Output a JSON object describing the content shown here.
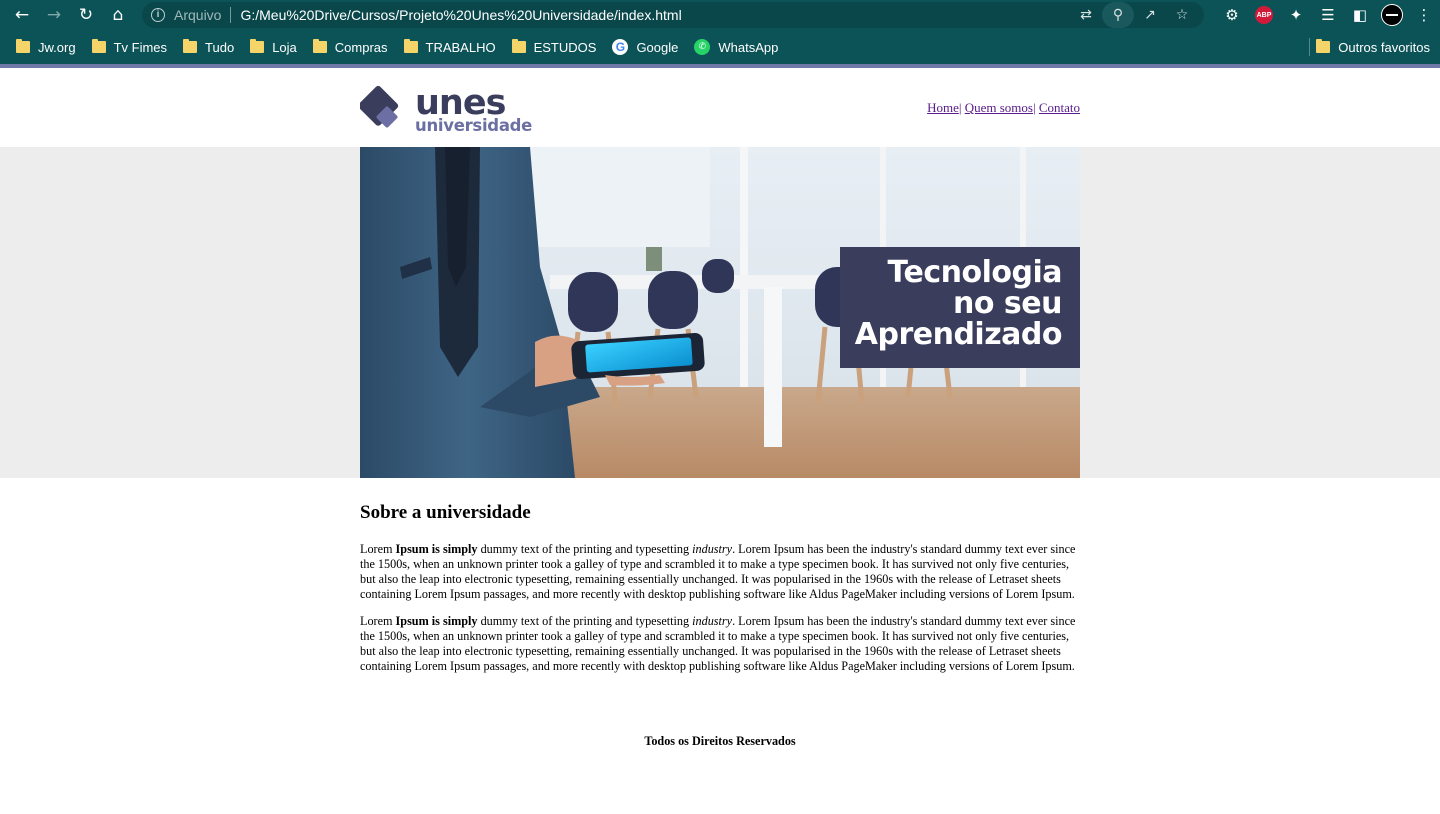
{
  "browser": {
    "address_scheme": "Arquivo",
    "address_url": "G:/Meu%20Drive/Cursos/Projeto%20Unes%20Universidade/index.html",
    "extensions": {
      "adblock_label": "ABP"
    },
    "bookmarks": [
      {
        "label": "Jw.org",
        "icon": "folder-icon"
      },
      {
        "label": "Tv Fimes",
        "icon": "folder-icon"
      },
      {
        "label": "Tudo",
        "icon": "folder-icon"
      },
      {
        "label": "Loja",
        "icon": "folder-icon"
      },
      {
        "label": "Compras",
        "icon": "folder-icon"
      },
      {
        "label": "TRABALHO",
        "icon": "folder-icon"
      },
      {
        "label": "ESTUDOS",
        "icon": "folder-icon"
      },
      {
        "label": "Google",
        "icon": "google-icon"
      },
      {
        "label": "WhatsApp",
        "icon": "whatsapp-icon"
      }
    ],
    "other_bookmarks_label": "Outros favoritos",
    "theme_color": "#0c5357"
  },
  "site": {
    "logo": {
      "wordmark": "unes",
      "subword": "universidade",
      "color": "#3a3d5c",
      "accent": "#6b6fa3"
    },
    "nav": {
      "home": "Home",
      "about": "Quem somos",
      "contact": "Contato",
      "separator": "|"
    },
    "banner": {
      "caption_line1": "Tecnologia",
      "caption_line2": "no seu",
      "caption_line3": "Aprendizado",
      "caption_bg": "#3a3d5c"
    },
    "about": {
      "title": "Sobre a universidade",
      "paragraphs": [
        {
          "lead": "Lorem ",
          "bold": "Ipsum is simply",
          "mid": " dummy text of the printing and typesetting ",
          "italic": "industry",
          "rest": ". Lorem Ipsum has been the industry's standard dummy text ever since the 1500s, when an unknown printer took a galley of type and scrambled it to make a type specimen book. It has survived not only five centuries, but also the leap into electronic typesetting, remaining essentially unchanged. It was popularised in the 1960s with the release of Letraset sheets containing Lorem Ipsum passages, and more recently with desktop publishing software like Aldus PageMaker including versions of Lorem Ipsum."
        },
        {
          "lead": "Lorem ",
          "bold": "Ipsum is simply",
          "mid": " dummy text of the printing and typesetting ",
          "italic": "industry",
          "rest": ". Lorem Ipsum has been the industry's standard dummy text ever since the 1500s, when an unknown printer took a galley of type and scrambled it to make a type specimen book. It has survived not only five centuries, but also the leap into electronic typesetting, remaining essentially unchanged. It was popularised in the 1960s with the release of Letraset sheets containing Lorem Ipsum passages, and more recently with desktop publishing software like Aldus PageMaker including versions of Lorem Ipsum."
        }
      ]
    },
    "footer": "Todos os Direitos Reservados"
  }
}
